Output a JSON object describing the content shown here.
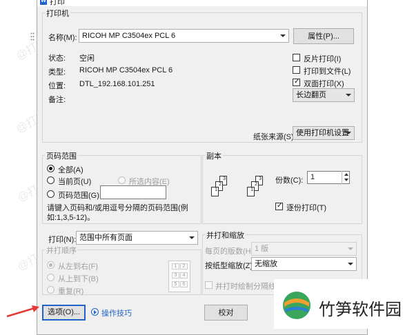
{
  "window": {
    "title": "打印"
  },
  "printer_group": {
    "label": "打印机",
    "name_label": "名称(M):",
    "name_value": "RICOH MP C3504ex PCL 6",
    "properties_button": "属性(P)...",
    "status_label": "状态:",
    "status_value": "空闲",
    "type_label": "类型:",
    "type_value": "RICOH MP C3504ex PCL 6",
    "where_label": "位置:",
    "where_value": "DTL_192.168.101.251",
    "comment_label": "备注:",
    "reverse_print": {
      "label": "反片打印(I)",
      "checked": false
    },
    "print_to_file": {
      "label": "打印到文件(L)",
      "checked": false
    },
    "duplex": {
      "label": "双面打印(X)",
      "checked": true
    },
    "duplex_mode": "长边翻页",
    "paper_source_label": "纸张来源(S):",
    "paper_source_value": "使用打印机设置"
  },
  "page_range": {
    "label": "页码范围",
    "all": "全部(A)",
    "current": "当前页(U)",
    "selection": "所选内容(E)",
    "pages": "页码范围(G):",
    "pages_value": "",
    "hint": "请键入页码和/或用逗号分隔的页码范围(例如:1,3,5-12)。"
  },
  "copies": {
    "label": "副本",
    "count_label": "份数(C):",
    "count_value": "1",
    "collate": {
      "label": "逐份打印(T)",
      "checked": true
    },
    "page_labels": [
      "3",
      "2",
      "1",
      "3",
      "2",
      "1"
    ]
  },
  "print_what": {
    "label": "打印(N):",
    "value": "范围中所有页面"
  },
  "print_order": {
    "label": "并打顺序",
    "left_to_right": "从左到右(F)",
    "top_to_bottom": "从上到下(B)",
    "repeat": "重复(R)",
    "grid_labels": [
      "1",
      "2",
      "3",
      "4",
      "5",
      "6"
    ]
  },
  "zoom": {
    "label": "并打和缩放",
    "pages_per_sheet_label": "每页的版数(H):",
    "pages_per_sheet_value": "1 版",
    "scale_label": "按纸型缩放(Z):",
    "scale_value": "无缩放",
    "draw_borders": {
      "label": "并打时绘制分隔线(D)",
      "checked": false
    }
  },
  "footer": {
    "options_button": "选项(O)...",
    "tips_link": "操作技巧",
    "ok_button": "校对"
  },
  "watermark": {
    "text": "@打印机卫士",
    "brand": "竹笋软件园"
  },
  "colors": {
    "accent": "#1e64c8",
    "arrow": "#e53935",
    "logo_green": "#3aa65b",
    "logo_orange": "#f0a030",
    "logo_blue": "#2d7fd3"
  }
}
